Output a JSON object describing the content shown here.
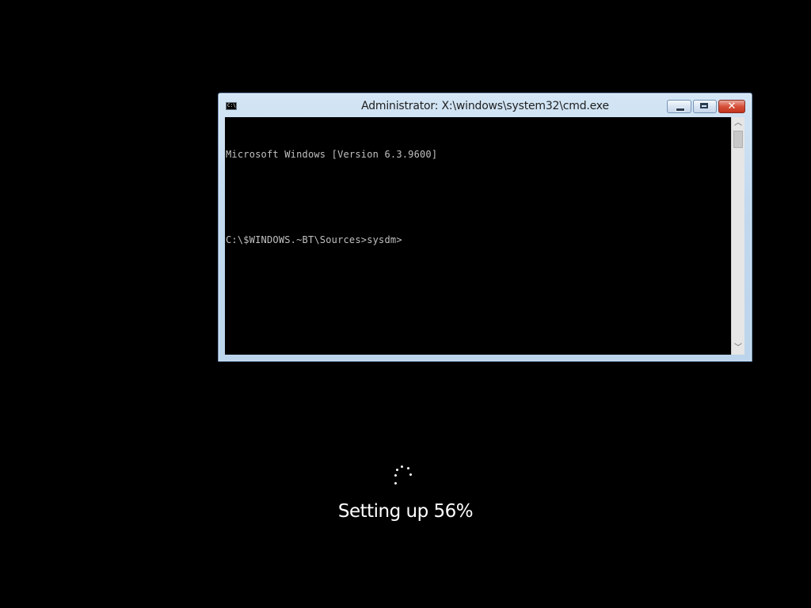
{
  "window": {
    "title": "Administrator: X:\\windows\\system32\\cmd.exe",
    "icon": "cmd-icon",
    "icon_glyph": "C:\\",
    "buttons": {
      "minimize": "minimize-icon",
      "maximize": "maximize-icon",
      "close": "close-icon",
      "close_glyph": "✕"
    },
    "accent_color": "#c2d9ef",
    "close_color": "#c2341d"
  },
  "console": {
    "lines": [
      "Microsoft Windows [Version 6.3.9600]",
      "",
      "C:\\$WINDOWS.~BT\\Sources>sysdm>"
    ],
    "text_color": "#c0c0c0",
    "background": "#000000"
  },
  "scrollbar": {
    "up_arrow": "︿",
    "down_arrow": "﹀"
  },
  "setup": {
    "status": "Setting up 56%",
    "progress_percent": 56,
    "spinner_icon": "loading-spinner-icon"
  }
}
